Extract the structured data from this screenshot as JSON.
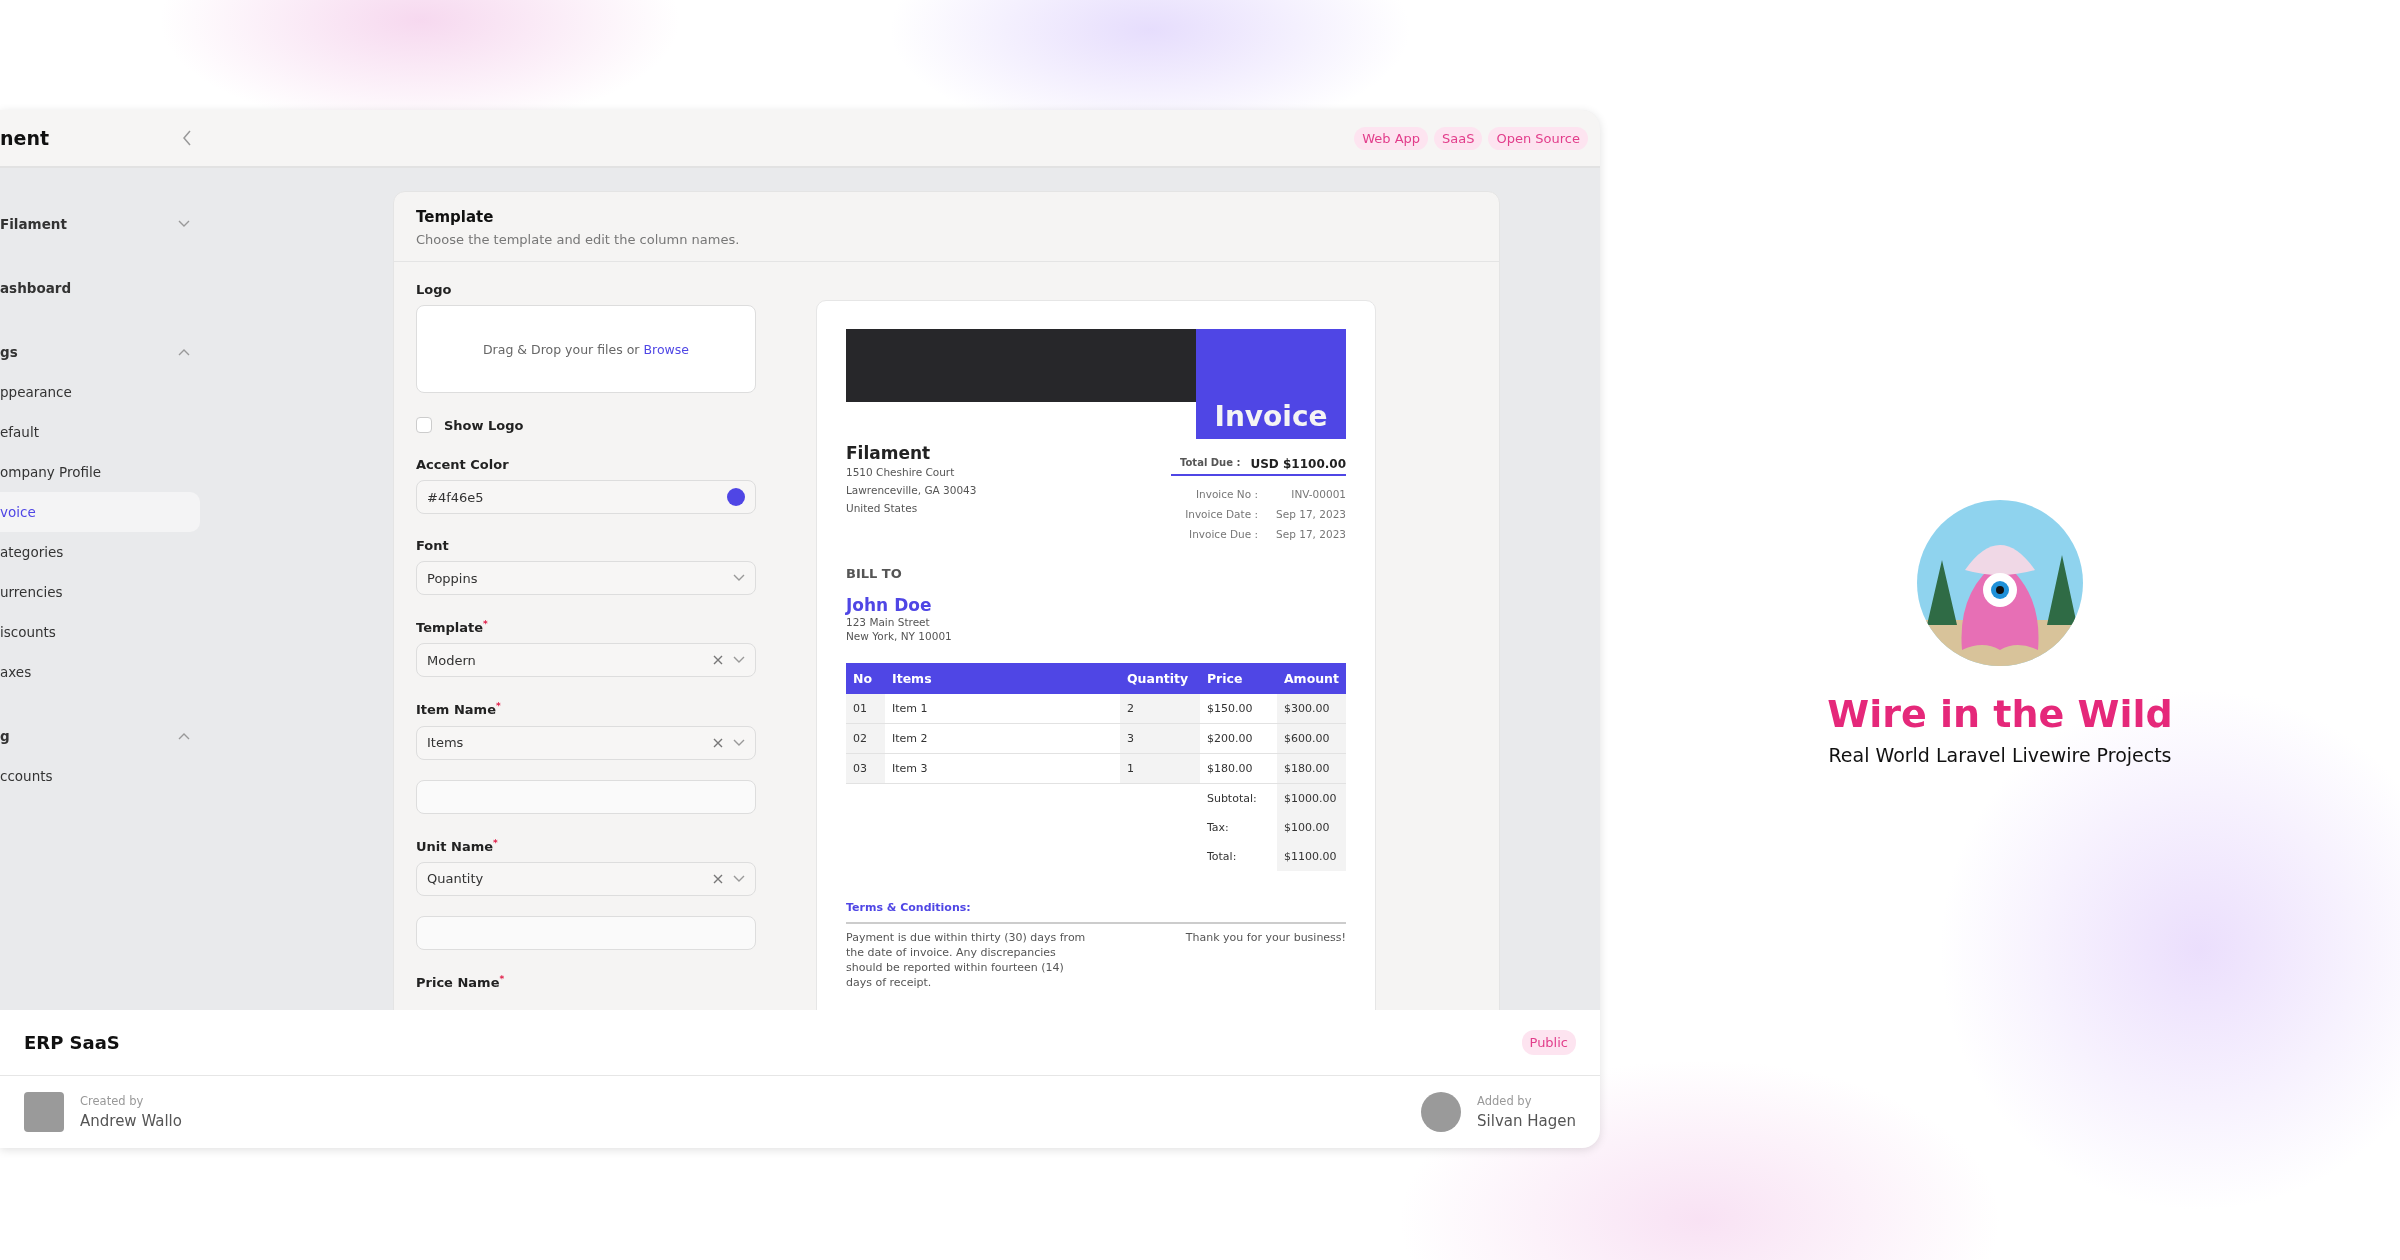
{
  "app_header": {
    "title": "nent",
    "tags": [
      "Web App",
      "SaaS",
      "Open Source"
    ]
  },
  "sidebar": {
    "items": [
      {
        "kind": "group",
        "label": "Filament",
        "expanded": false
      },
      {
        "kind": "link",
        "label": "ashboard",
        "selected": false
      },
      {
        "kind": "group",
        "label": "gs",
        "expanded": true,
        "children": [
          {
            "label": "ppearance",
            "selected": false
          },
          {
            "label": "efault",
            "selected": false
          },
          {
            "label": "ompany Profile",
            "selected": false
          },
          {
            "label": "voice",
            "selected": true
          },
          {
            "label": "ategories",
            "selected": false
          },
          {
            "label": "urrencies",
            "selected": false
          },
          {
            "label": "iscounts",
            "selected": false
          },
          {
            "label": "axes",
            "selected": false
          }
        ]
      },
      {
        "kind": "group",
        "label": "g",
        "expanded": true,
        "children": [
          {
            "label": "ccounts",
            "selected": false
          }
        ]
      }
    ]
  },
  "template_section": {
    "title": "Template",
    "description": "Choose the template and edit the column names.",
    "fields": [
      {
        "kind": "upload",
        "label": "Logo",
        "text": "Drag & Drop your files or",
        "link": "Browse"
      },
      {
        "kind": "checkbox",
        "label": "Show Logo",
        "checked": false
      },
      {
        "kind": "color",
        "label": "Accent Color",
        "value": "#4f46e5"
      },
      {
        "kind": "select",
        "label": "Font",
        "value": "Poppins",
        "clearable": false
      },
      {
        "kind": "select",
        "label": "Template",
        "value": "Modern",
        "required_mark": "*",
        "clearable": true
      },
      {
        "kind": "select",
        "label": "Item Name",
        "value": "Items",
        "required_mark": "*",
        "clearable": true
      },
      {
        "kind": "text"
      },
      {
        "kind": "select",
        "label": "Unit Name",
        "value": "Quantity",
        "required_mark": "*",
        "clearable": true
      },
      {
        "kind": "text"
      },
      {
        "kind": "label",
        "label": "Price Name",
        "required_mark": "*"
      }
    ]
  },
  "invoice_preview": {
    "heading": "Invoice",
    "company": "Filament",
    "company_address": [
      "1510 Cheshire Court",
      "Lawrenceville, GA 30043",
      "United States"
    ],
    "total_due": {
      "label": "Total Due :",
      "value": "USD $1100.00"
    },
    "meta": [
      {
        "label": "Invoice No :",
        "value": "INV-00001"
      },
      {
        "label": "Invoice Date :",
        "value": "Sep 17, 2023"
      },
      {
        "label": "Invoice Due :",
        "value": "Sep 17, 2023"
      }
    ],
    "bill_to_label": "BILL TO",
    "client_name": "John Doe",
    "client_address": [
      "123 Main Street",
      "New York, NY 10001"
    ],
    "table": {
      "columns": [
        "No",
        "Items",
        "Quantity",
        "Price",
        "Amount"
      ],
      "rows": [
        [
          "01",
          "Item 1",
          "2",
          "$150.00",
          "$300.00"
        ],
        [
          "02",
          "Item 2",
          "3",
          "$200.00",
          "$600.00"
        ],
        [
          "03",
          "Item 3",
          "1",
          "$180.00",
          "$180.00"
        ]
      ],
      "totals": [
        {
          "label": "Subtotal:",
          "value": "$1000.00"
        },
        {
          "label": "Tax:",
          "value": "$100.00"
        },
        {
          "label": "Total:",
          "value": "$1100.00"
        }
      ]
    },
    "terms_title": "Terms & Conditions:",
    "terms_text": "Payment is due within thirty (30) days from the date of invoice. Any discrepancies should be reported within fourteen (14) days of receipt.",
    "thanks": "Thank you for your business!"
  },
  "project": {
    "title": "ERP SaaS",
    "badge": "Public",
    "creator": {
      "label": "Created by",
      "name": "Andrew Wallo"
    },
    "adder": {
      "label": "Added by",
      "name": "Silvan Hagen"
    }
  },
  "brand": {
    "title": "Wire in the Wild",
    "subtitle": "Real World Laravel Livewire Projects"
  }
}
